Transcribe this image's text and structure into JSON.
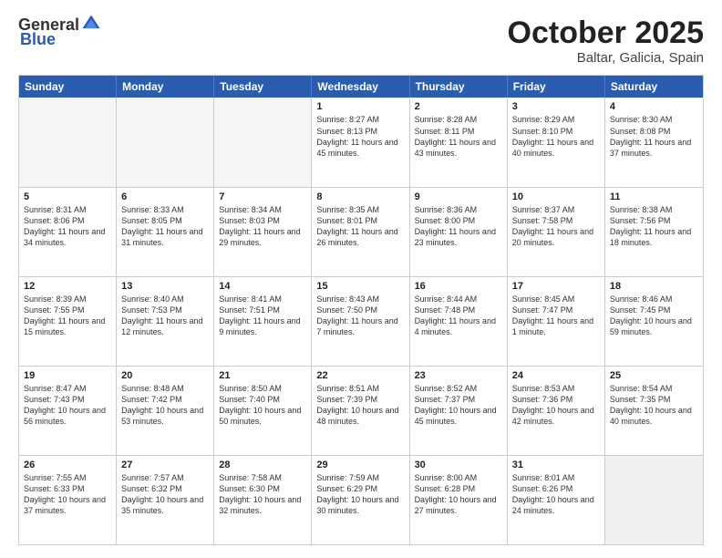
{
  "header": {
    "logo_general": "General",
    "logo_blue": "Blue",
    "title": "October 2025",
    "subtitle": "Baltar, Galicia, Spain"
  },
  "weekdays": [
    "Sunday",
    "Monday",
    "Tuesday",
    "Wednesday",
    "Thursday",
    "Friday",
    "Saturday"
  ],
  "rows": [
    [
      {
        "day": "",
        "text": "",
        "empty": true
      },
      {
        "day": "",
        "text": "",
        "empty": true
      },
      {
        "day": "",
        "text": "",
        "empty": true
      },
      {
        "day": "1",
        "text": "Sunrise: 8:27 AM\nSunset: 8:13 PM\nDaylight: 11 hours and 45 minutes."
      },
      {
        "day": "2",
        "text": "Sunrise: 8:28 AM\nSunset: 8:11 PM\nDaylight: 11 hours and 43 minutes."
      },
      {
        "day": "3",
        "text": "Sunrise: 8:29 AM\nSunset: 8:10 PM\nDaylight: 11 hours and 40 minutes."
      },
      {
        "day": "4",
        "text": "Sunrise: 8:30 AM\nSunset: 8:08 PM\nDaylight: 11 hours and 37 minutes."
      }
    ],
    [
      {
        "day": "5",
        "text": "Sunrise: 8:31 AM\nSunset: 8:06 PM\nDaylight: 11 hours and 34 minutes."
      },
      {
        "day": "6",
        "text": "Sunrise: 8:33 AM\nSunset: 8:05 PM\nDaylight: 11 hours and 31 minutes."
      },
      {
        "day": "7",
        "text": "Sunrise: 8:34 AM\nSunset: 8:03 PM\nDaylight: 11 hours and 29 minutes."
      },
      {
        "day": "8",
        "text": "Sunrise: 8:35 AM\nSunset: 8:01 PM\nDaylight: 11 hours and 26 minutes."
      },
      {
        "day": "9",
        "text": "Sunrise: 8:36 AM\nSunset: 8:00 PM\nDaylight: 11 hours and 23 minutes."
      },
      {
        "day": "10",
        "text": "Sunrise: 8:37 AM\nSunset: 7:58 PM\nDaylight: 11 hours and 20 minutes."
      },
      {
        "day": "11",
        "text": "Sunrise: 8:38 AM\nSunset: 7:56 PM\nDaylight: 11 hours and 18 minutes."
      }
    ],
    [
      {
        "day": "12",
        "text": "Sunrise: 8:39 AM\nSunset: 7:55 PM\nDaylight: 11 hours and 15 minutes."
      },
      {
        "day": "13",
        "text": "Sunrise: 8:40 AM\nSunset: 7:53 PM\nDaylight: 11 hours and 12 minutes."
      },
      {
        "day": "14",
        "text": "Sunrise: 8:41 AM\nSunset: 7:51 PM\nDaylight: 11 hours and 9 minutes."
      },
      {
        "day": "15",
        "text": "Sunrise: 8:43 AM\nSunset: 7:50 PM\nDaylight: 11 hours and 7 minutes."
      },
      {
        "day": "16",
        "text": "Sunrise: 8:44 AM\nSunset: 7:48 PM\nDaylight: 11 hours and 4 minutes."
      },
      {
        "day": "17",
        "text": "Sunrise: 8:45 AM\nSunset: 7:47 PM\nDaylight: 11 hours and 1 minute."
      },
      {
        "day": "18",
        "text": "Sunrise: 8:46 AM\nSunset: 7:45 PM\nDaylight: 10 hours and 59 minutes."
      }
    ],
    [
      {
        "day": "19",
        "text": "Sunrise: 8:47 AM\nSunset: 7:43 PM\nDaylight: 10 hours and 56 minutes."
      },
      {
        "day": "20",
        "text": "Sunrise: 8:48 AM\nSunset: 7:42 PM\nDaylight: 10 hours and 53 minutes."
      },
      {
        "day": "21",
        "text": "Sunrise: 8:50 AM\nSunset: 7:40 PM\nDaylight: 10 hours and 50 minutes."
      },
      {
        "day": "22",
        "text": "Sunrise: 8:51 AM\nSunset: 7:39 PM\nDaylight: 10 hours and 48 minutes."
      },
      {
        "day": "23",
        "text": "Sunrise: 8:52 AM\nSunset: 7:37 PM\nDaylight: 10 hours and 45 minutes."
      },
      {
        "day": "24",
        "text": "Sunrise: 8:53 AM\nSunset: 7:36 PM\nDaylight: 10 hours and 42 minutes."
      },
      {
        "day": "25",
        "text": "Sunrise: 8:54 AM\nSunset: 7:35 PM\nDaylight: 10 hours and 40 minutes."
      }
    ],
    [
      {
        "day": "26",
        "text": "Sunrise: 7:55 AM\nSunset: 6:33 PM\nDaylight: 10 hours and 37 minutes."
      },
      {
        "day": "27",
        "text": "Sunrise: 7:57 AM\nSunset: 6:32 PM\nDaylight: 10 hours and 35 minutes."
      },
      {
        "day": "28",
        "text": "Sunrise: 7:58 AM\nSunset: 6:30 PM\nDaylight: 10 hours and 32 minutes."
      },
      {
        "day": "29",
        "text": "Sunrise: 7:59 AM\nSunset: 6:29 PM\nDaylight: 10 hours and 30 minutes."
      },
      {
        "day": "30",
        "text": "Sunrise: 8:00 AM\nSunset: 6:28 PM\nDaylight: 10 hours and 27 minutes."
      },
      {
        "day": "31",
        "text": "Sunrise: 8:01 AM\nSunset: 6:26 PM\nDaylight: 10 hours and 24 minutes."
      },
      {
        "day": "",
        "text": "",
        "empty": true,
        "shaded": true
      }
    ]
  ]
}
